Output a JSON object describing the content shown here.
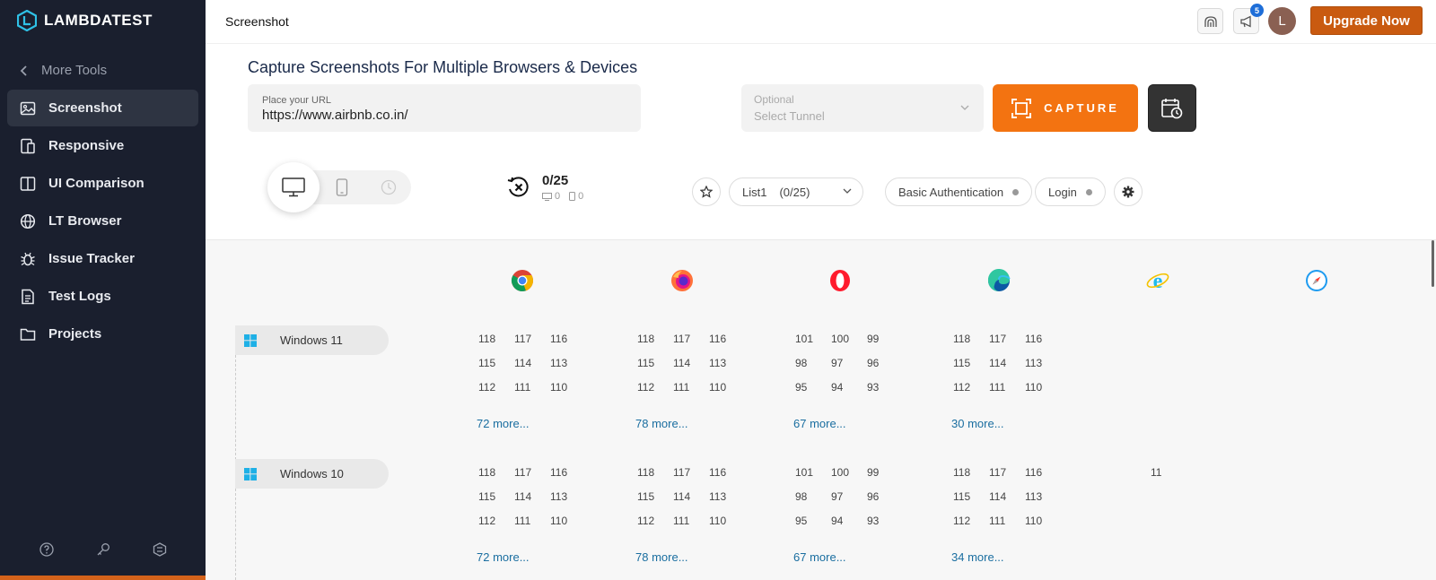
{
  "sidebar": {
    "logo": "LAMBDATEST",
    "more_tools": "More Tools",
    "items": [
      {
        "label": "Screenshot",
        "icon": "image-icon",
        "active": true
      },
      {
        "label": "Responsive",
        "icon": "responsive-icon"
      },
      {
        "label": "UI Comparison",
        "icon": "compare-icon"
      },
      {
        "label": "LT Browser",
        "icon": "globe-icon"
      },
      {
        "label": "Issue Tracker",
        "icon": "bug-icon"
      },
      {
        "label": "Test Logs",
        "icon": "doc-icon"
      },
      {
        "label": "Projects",
        "icon": "folder-icon"
      }
    ]
  },
  "header": {
    "title": "Screenshot",
    "notification_count": "5",
    "avatar_initial": "L",
    "upgrade_label": "Upgrade Now"
  },
  "main": {
    "title": "Capture Screenshots For Multiple Browsers & Devices",
    "url_label": "Place your URL",
    "url_value": "https://www.airbnb.co.in/",
    "tunnel_label": "Optional",
    "tunnel_placeholder": "Select Tunnel",
    "capture_label": "CAPTURE",
    "counter": "0/25",
    "desktop_count": "0",
    "mobile_count": "0",
    "list_label": "List1",
    "list_count": "(0/25)",
    "basic_auth_label": "Basic Authentication",
    "login_label": "Login"
  },
  "browsers": [
    "chrome",
    "firefox",
    "opera",
    "edge",
    "internet-explorer",
    "safari"
  ],
  "os_rows": [
    {
      "name": "Windows 11",
      "chrome": {
        "versions": [
          "118",
          "117",
          "116",
          "115",
          "114",
          "113",
          "112",
          "111",
          "110"
        ],
        "more": "72 more..."
      },
      "firefox": {
        "versions": [
          "118",
          "117",
          "116",
          "115",
          "114",
          "113",
          "112",
          "111",
          "110"
        ],
        "more": "78 more..."
      },
      "opera": {
        "versions": [
          "101",
          "100",
          "99",
          "98",
          "97",
          "96",
          "95",
          "94",
          "93"
        ],
        "more": "67 more..."
      },
      "edge": {
        "versions": [
          "118",
          "117",
          "116",
          "115",
          "114",
          "113",
          "112",
          "111",
          "110"
        ],
        "more": "30 more..."
      },
      "ie": {
        "versions": []
      }
    },
    {
      "name": "Windows 10",
      "chrome": {
        "versions": [
          "118",
          "117",
          "116",
          "115",
          "114",
          "113",
          "112",
          "111",
          "110"
        ],
        "more": "72 more..."
      },
      "firefox": {
        "versions": [
          "118",
          "117",
          "116",
          "115",
          "114",
          "113",
          "112",
          "111",
          "110"
        ],
        "more": "78 more..."
      },
      "opera": {
        "versions": [
          "101",
          "100",
          "99",
          "98",
          "97",
          "96",
          "95",
          "94",
          "93"
        ],
        "more": "67 more..."
      },
      "edge": {
        "versions": [
          "118",
          "117",
          "116",
          "115",
          "114",
          "113",
          "112",
          "111",
          "110"
        ],
        "more": "34 more..."
      },
      "ie": {
        "versions": [
          "11"
        ]
      }
    }
  ],
  "colors": {
    "sidebar_bg": "#1a1f2e",
    "capture": "#f37311",
    "upgrade": "#c95a10",
    "link": "#1a6ea0"
  }
}
